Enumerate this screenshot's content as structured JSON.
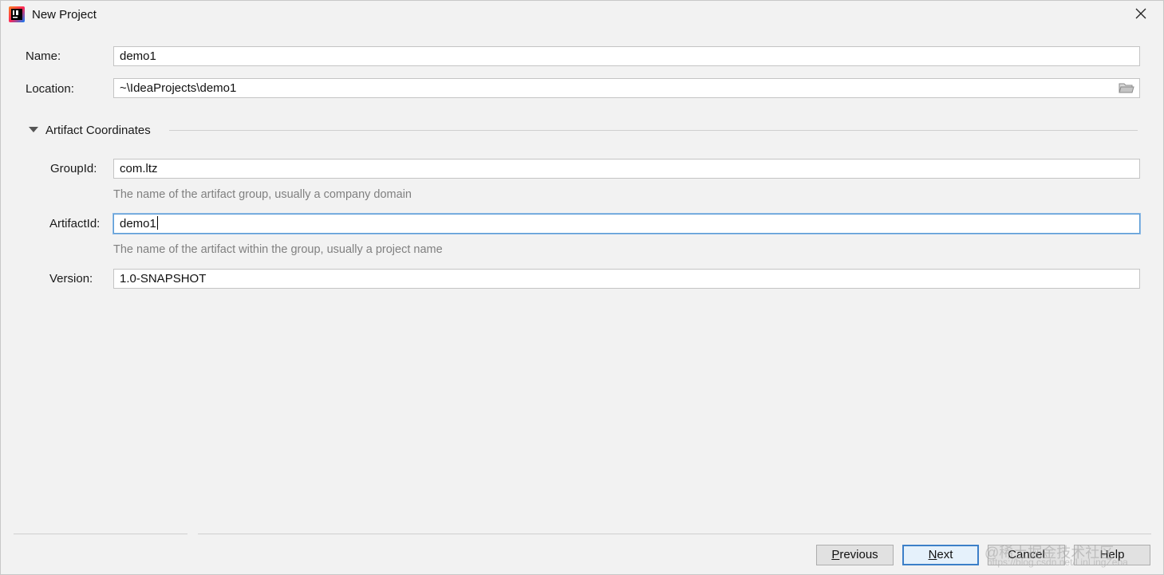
{
  "window": {
    "title": "New Project"
  },
  "form": {
    "name": {
      "label": "Name:",
      "value": "demo1"
    },
    "location": {
      "label": "Location:",
      "value": "~\\IdeaProjects\\demo1",
      "icon": "folder-icon"
    },
    "section": {
      "title": "Artifact Coordinates",
      "expanded": true
    },
    "group_id": {
      "label": "GroupId:",
      "value": "com.ltz",
      "hint": "The name of the artifact group, usually a company domain"
    },
    "artifact_id": {
      "label": "ArtifactId:",
      "value": "demo1",
      "hint": "The name of the artifact within the group, usually a project name"
    },
    "version": {
      "label": "Version:",
      "value": "1.0-SNAPSHOT"
    }
  },
  "buttons": {
    "previous": {
      "mnemonic": "P",
      "rest": "revious"
    },
    "next": {
      "mnemonic": "N",
      "rest": "ext"
    },
    "cancel": "Cancel",
    "help": "Help"
  },
  "watermark": {
    "text": "@稀土掘金技术社区",
    "url": "https://blog.csdn.net/LinLingZeba"
  },
  "colors": {
    "focus_border": "#5a9bd5",
    "hint_text": "#808080",
    "background": "#f2f2f2"
  }
}
